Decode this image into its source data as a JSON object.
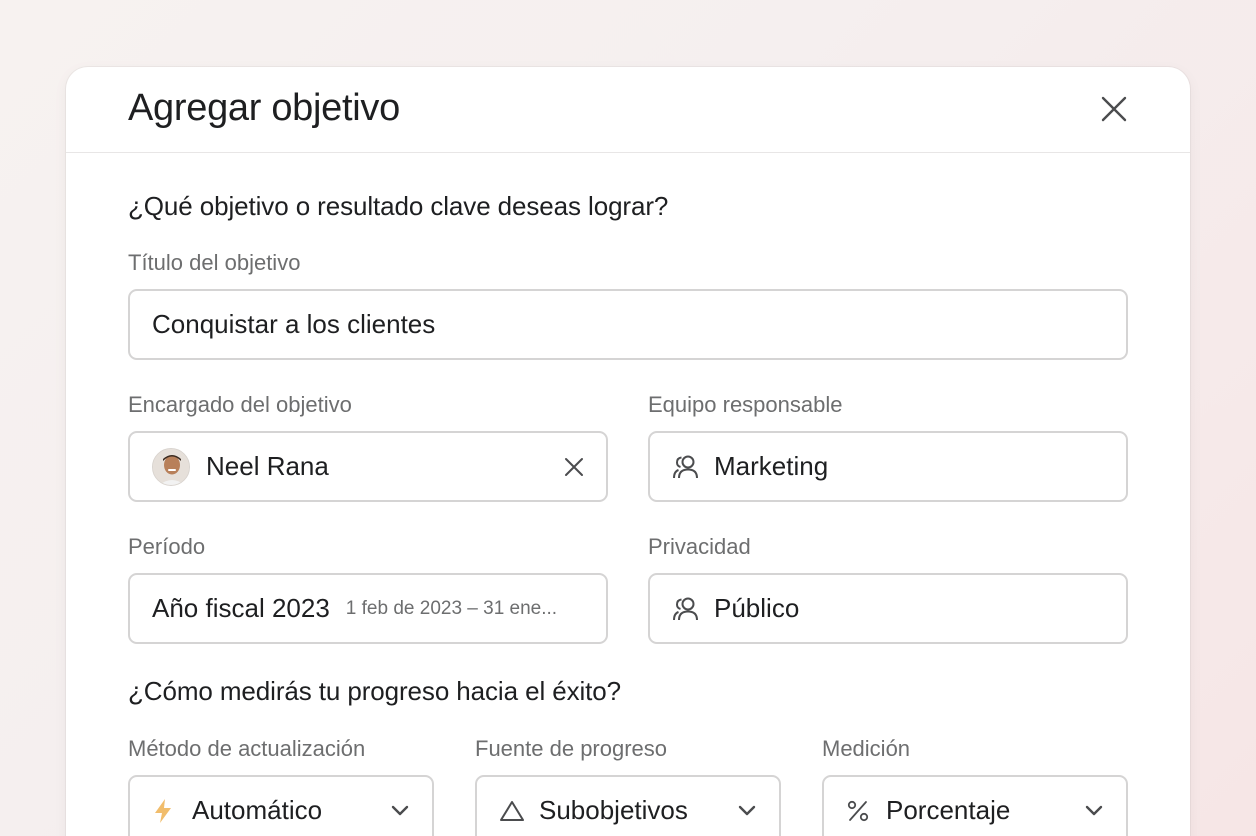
{
  "modal": {
    "title": "Agregar objetivo"
  },
  "section1": {
    "title": "¿Qué objetivo o resultado clave deseas lograr?",
    "goal_title": {
      "label": "Título del objetivo",
      "value": "Conquistar a los clientes"
    },
    "owner": {
      "label": "Encargado del objetivo",
      "value": "Neel Rana"
    },
    "team": {
      "label": "Equipo responsable",
      "value": "Marketing",
      "icon": "team-icon"
    },
    "period": {
      "label": "Período",
      "value": "Año fiscal 2023",
      "range": "1 feb de 2023 – 31 ene..."
    },
    "privacy": {
      "label": "Privacidad",
      "value": "Público",
      "icon": "team-icon"
    }
  },
  "section2": {
    "title": "¿Cómo medirás tu progreso hacia el éxito?",
    "update_method": {
      "label": "Método de actualización",
      "value": "Automático",
      "icon": "lightning-icon"
    },
    "progress_source": {
      "label": "Fuente de progreso",
      "value": "Subobjetivos",
      "icon": "triangle-icon"
    },
    "measurement": {
      "label": "Medición",
      "value": "Porcentaje",
      "icon": "percent-icon"
    }
  },
  "colors": {
    "text": "#1e1f21",
    "label": "#6d6e6f",
    "border": "#d5d4d4",
    "lightning": "#f1bd6c"
  }
}
